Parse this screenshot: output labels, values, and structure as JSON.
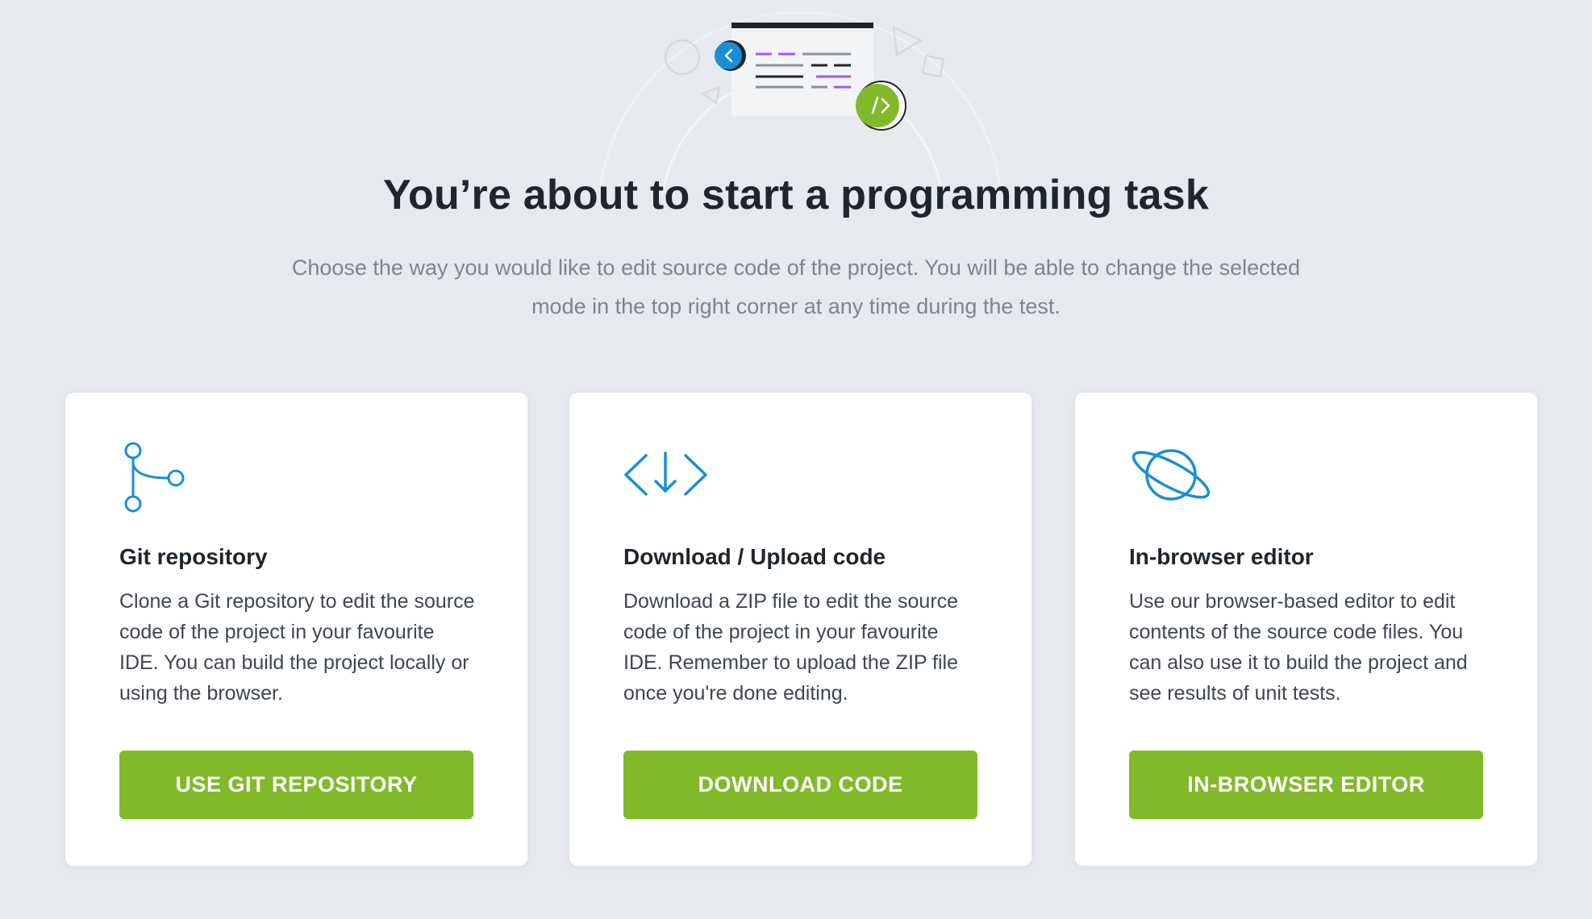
{
  "header": {
    "title": "You’re about to start a programming task",
    "subtitle": "Choose the way you would like to edit source code of the project. You will be able to change the selected mode in the top right corner at any time during the test."
  },
  "colors": {
    "background": "#e6e9ed",
    "accent_green": "#82b92b",
    "icon_blue": "#1a8fd6",
    "code_purple": "#a855f7"
  },
  "options": [
    {
      "icon": "git-branch-icon",
      "title": "Git repository",
      "description": "Clone a Git repository to edit the source code of the project in your favourite IDE. You can build the project locally or using the browser.",
      "button_label": "USE GIT REPOSITORY"
    },
    {
      "icon": "download-code-icon",
      "title": "Download / Upload code",
      "description": "Download a ZIP file to edit the source code of the project in your favourite IDE. Remember to upload the ZIP file once you're done editing.",
      "button_label": "DOWNLOAD CODE"
    },
    {
      "icon": "planet-icon",
      "title": "In-browser editor",
      "description": "Use our browser-based editor to edit contents of the source code files. You can also use it to build the project and see results of unit tests.",
      "button_label": "IN-BROWSER EDITOR"
    }
  ]
}
